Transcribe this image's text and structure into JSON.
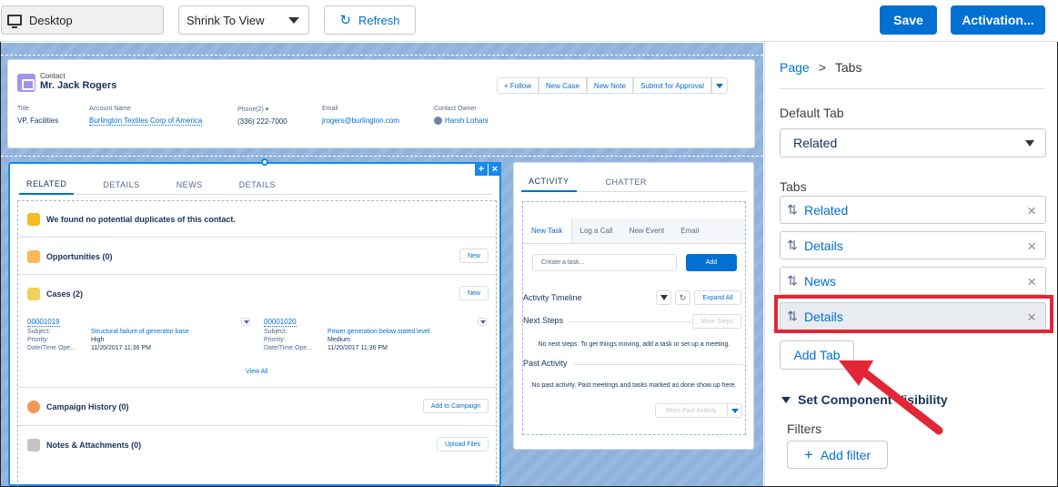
{
  "toolbar": {
    "device_label": "Desktop",
    "view_select": "Shrink To View",
    "refresh_label": "Refresh",
    "save_label": "Save",
    "activation_label": "Activation..."
  },
  "contact": {
    "type_label": "Contact",
    "name": "Mr. Jack Rogers",
    "buttons": [
      "+ Follow",
      "New Case",
      "New Note",
      "Submit for Approval"
    ],
    "fields": [
      {
        "label": "Title",
        "value": "VP, Facilities"
      },
      {
        "label": "Account Name",
        "value": "Burlington Textiles Corp of America"
      },
      {
        "label": "Phone(2) ▾",
        "value": "(336) 222-7000"
      },
      {
        "label": "Email",
        "value": "jrogers@burlington.com"
      },
      {
        "label": "Contact Owner",
        "value": "Harsh Lohani"
      }
    ]
  },
  "related": {
    "tabs": [
      "RELATED",
      "DETAILS",
      "NEWS",
      "DETAILS"
    ],
    "duplicates_msg": "We found no potential duplicates of this contact.",
    "opportunities": {
      "title": "Opportunities (0)",
      "button": "New"
    },
    "cases": {
      "title": "Cases (2)",
      "button": "New",
      "items": [
        {
          "number": "00001019",
          "subject": "Structural failure of generator base",
          "priority": "High",
          "datetime": "11/20/2017 11:36 PM"
        },
        {
          "number": "00001020",
          "subject": "Power generation below stated level",
          "priority": "Medium",
          "datetime": "11/20/2017 11:36 PM"
        }
      ],
      "labels": {
        "subject": "Subject:",
        "priority": "Priority:",
        "datetime": "Date/Time Ope..."
      },
      "view_all": "View All"
    },
    "campaign": {
      "title": "Campaign History (0)",
      "button": "Add to Campaign"
    },
    "notes": {
      "title": "Notes & Attachments (0)",
      "button": "Upload Files"
    }
  },
  "activity": {
    "tabs": [
      "ACTIVITY",
      "CHATTER"
    ],
    "sub_tabs": [
      "New Task",
      "Log a Call",
      "New Event",
      "Email"
    ],
    "task_placeholder": "Create a task...",
    "add_label": "Add",
    "timeline_label": "Activity Timeline",
    "expand_all": "Expand All",
    "next_steps": "Next Steps",
    "more_steps": "More Steps",
    "next_steps_msg": "No next steps. To get things moving, add a task or set up a meeting.",
    "past_activity": "Past Activity",
    "past_msg": "No past activity. Past meetings and tasks marked as done show up here.",
    "more_past": "More Past Activity"
  },
  "panel": {
    "breadcrumb": {
      "page": "Page",
      "sep": ">",
      "current": "Tabs"
    },
    "default_tab_label": "Default Tab",
    "default_tab_value": "Related",
    "tabs_label": "Tabs",
    "tab_items": [
      "Related",
      "Details",
      "News",
      "Details"
    ],
    "add_tab": "Add Tab",
    "visibility": "Set Component Visibility",
    "filters_label": "Filters",
    "add_filter": "Add filter"
  },
  "colors": {
    "brand": "#0070d2",
    "highlight": "#e32636",
    "canvas": "#8fb3dc"
  }
}
